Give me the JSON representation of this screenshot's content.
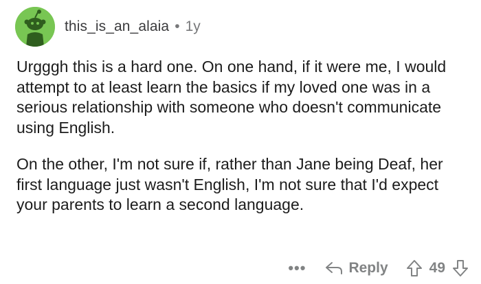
{
  "comment": {
    "username": "this_is_an_alaia",
    "separator": "•",
    "age": "1y",
    "avatar_color": "#78c653",
    "paragraphs": [
      "Urgggh this is a hard one. On one hand, if it were me, I would attempt to at least learn the basics if my loved one was in a serious relationship with someone who doesn't communicate using English.",
      "On the other, I'm not sure if, rather than Jane being Deaf, her first language just wasn't English, I'm not sure that I'd expect your parents to learn a second language."
    ]
  },
  "actions": {
    "more_label": "•••",
    "reply_label": "Reply",
    "score": "49",
    "icons": {
      "reply": "reply-arrow-icon",
      "upvote": "upvote-arrow-icon",
      "downvote": "downvote-arrow-icon"
    }
  }
}
